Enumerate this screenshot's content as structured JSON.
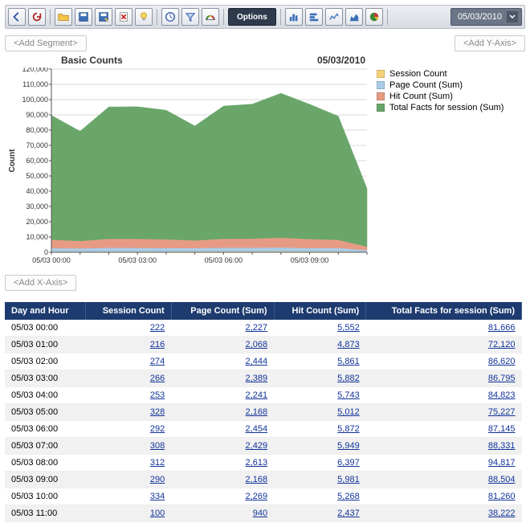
{
  "toolbar": {
    "options_label": "Options",
    "date_value": "05/03/2010"
  },
  "actions": {
    "add_segment": "<Add Segment>",
    "add_y_axis": "<Add Y-Axis>",
    "add_x_axis": "<Add X-Axis>"
  },
  "chart": {
    "title": "Basic Counts",
    "date_label": "05/03/2010",
    "ylabel": "Count"
  },
  "legend": {
    "items": [
      {
        "label": "Session Count",
        "color": "#f4d27a"
      },
      {
        "label": "Page Count (Sum)",
        "color": "#a8cce6"
      },
      {
        "label": "Hit Count (Sum)",
        "color": "#e79b84"
      },
      {
        "label": "Total Facts for session (Sum)",
        "color": "#6aa66a"
      }
    ]
  },
  "table": {
    "headers": {
      "h0": "Day and Hour",
      "h1": "Session Count",
      "h2": "Page Count (Sum)",
      "h3": "Hit Count (Sum)",
      "h4": "Total Facts for session (Sum)"
    },
    "rows": [
      {
        "hour": "05/03 00:00",
        "session": "222",
        "page": "2,227",
        "hit": "5,552",
        "total": "81,666"
      },
      {
        "hour": "05/03 01:00",
        "session": "216",
        "page": "2,068",
        "hit": "4,873",
        "total": "72,120"
      },
      {
        "hour": "05/03 02:00",
        "session": "274",
        "page": "2,444",
        "hit": "5,861",
        "total": "86,620"
      },
      {
        "hour": "05/03 03:00",
        "session": "266",
        "page": "2,389",
        "hit": "5,882",
        "total": "86,795"
      },
      {
        "hour": "05/03 04:00",
        "session": "253",
        "page": "2,241",
        "hit": "5,743",
        "total": "84,823"
      },
      {
        "hour": "05/03 05:00",
        "session": "328",
        "page": "2,168",
        "hit": "5,012",
        "total": "75,227"
      },
      {
        "hour": "05/03 06:00",
        "session": "292",
        "page": "2,454",
        "hit": "5,872",
        "total": "87,145"
      },
      {
        "hour": "05/03 07:00",
        "session": "308",
        "page": "2,429",
        "hit": "5,949",
        "total": "88,331"
      },
      {
        "hour": "05/03 08:00",
        "session": "312",
        "page": "2,613",
        "hit": "6,397",
        "total": "94,817"
      },
      {
        "hour": "05/03 09:00",
        "session": "290",
        "page": "2,168",
        "hit": "5,981",
        "total": "88,504"
      },
      {
        "hour": "05/03 10:00",
        "session": "334",
        "page": "2,269",
        "hit": "5,268",
        "total": "81,260"
      },
      {
        "hour": "05/03 11:00",
        "session": "100",
        "page": "940",
        "hit": "2,437",
        "total": "38,222"
      }
    ]
  },
  "chart_data": {
    "type": "area",
    "stacked": true,
    "title": "Basic Counts",
    "subtitle": "05/03/2010",
    "xlabel": "",
    "ylabel": "Count",
    "ylim": [
      0,
      120000
    ],
    "yticks": [
      0,
      10000,
      20000,
      30000,
      40000,
      50000,
      60000,
      70000,
      80000,
      90000,
      100000,
      110000,
      120000
    ],
    "ytick_labels": [
      "0",
      "10,000",
      "20,000",
      "30,000",
      "40,000",
      "50,000",
      "60,000",
      "70,000",
      "80,000",
      "90,000",
      "100,000",
      "110,000",
      "120,000"
    ],
    "categories": [
      "05/03 00:00",
      "05/03 01:00",
      "05/03 02:00",
      "05/03 03:00",
      "05/03 04:00",
      "05/03 05:00",
      "05/03 06:00",
      "05/03 07:00",
      "05/03 08:00",
      "05/03 09:00",
      "05/03 10:00",
      "05/03 11:00"
    ],
    "x_tick_labels": [
      "05/03 00:00",
      "05/03 03:00",
      "05/03 06:00",
      "05/03 09:00"
    ],
    "series": [
      {
        "name": "Session Count",
        "color": "#f4d27a",
        "values": [
          222,
          216,
          274,
          266,
          253,
          328,
          292,
          308,
          312,
          290,
          334,
          100
        ]
      },
      {
        "name": "Page Count (Sum)",
        "color": "#a8cce6",
        "values": [
          2227,
          2068,
          2444,
          2389,
          2241,
          2168,
          2454,
          2429,
          2613,
          2168,
          2269,
          940
        ]
      },
      {
        "name": "Hit Count (Sum)",
        "color": "#e79b84",
        "values": [
          5552,
          4873,
          5861,
          5882,
          5743,
          5012,
          5872,
          5949,
          6397,
          5981,
          5268,
          2437
        ]
      },
      {
        "name": "Total Facts for session (Sum)",
        "color": "#6aa66a",
        "values": [
          81666,
          72120,
          86620,
          86795,
          84823,
          75227,
          87145,
          88331,
          94817,
          88504,
          81260,
          38222
        ]
      }
    ]
  }
}
